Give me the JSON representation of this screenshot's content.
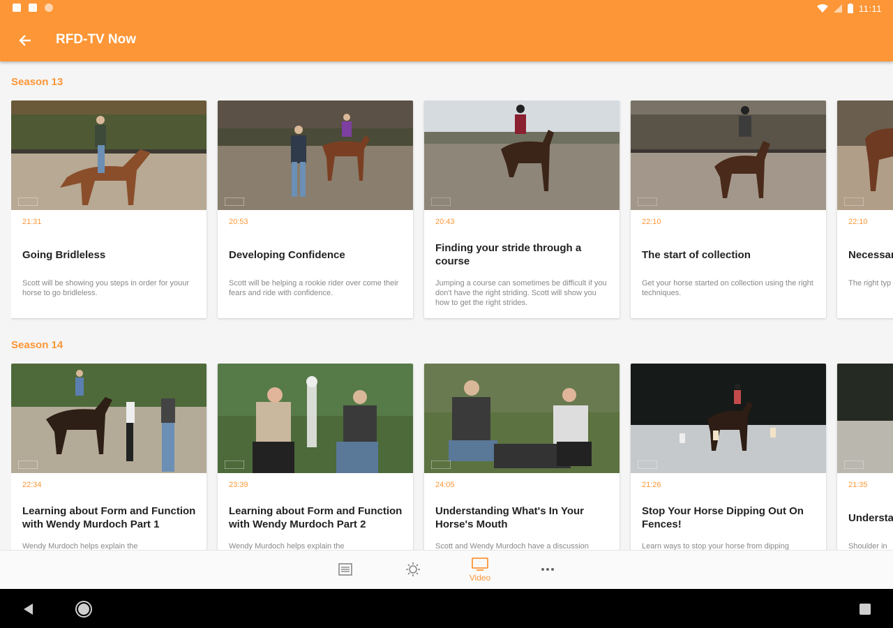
{
  "status_bar": {
    "time": "11:11"
  },
  "app_bar": {
    "title": "RFD-TV Now",
    "back_icon": "arrow-left-icon"
  },
  "colors": {
    "accent": "#fd9636",
    "title_text": "#222222",
    "desc_text": "#888888"
  },
  "seasons": [
    {
      "title": "Season 13",
      "episodes": [
        {
          "duration": "21:31",
          "title": "Going Bridleless",
          "description": "Scott will be showing you steps in order for youur horse to go bridleless."
        },
        {
          "duration": "20:53",
          "title": "Developing Confidence",
          "description": "Scott will be helping a rookie rider over come their fears and ride with confidence."
        },
        {
          "duration": "20:43",
          "title": "Finding your stride through a course",
          "description": "Jumping a course can sometimes be difficult if you don't have the right striding. Scott will show you how to get the right strides."
        },
        {
          "duration": "22:10",
          "title": "The start of collection",
          "description": "Get your horse started on collection using the right techniques."
        },
        {
          "duration": "22:10",
          "title": "Necessary young ho",
          "description": "The right typ horse will s future"
        }
      ]
    },
    {
      "title": "Season 14",
      "episodes": [
        {
          "duration": "22:34",
          "title": "Learning about Form and Function with Wendy Murdoch Part 1",
          "description": "Wendy Murdoch helps explain the"
        },
        {
          "duration": "23:39",
          "title": "Learning about Form and Function with Wendy Murdoch Part 2",
          "description": "Wendy Murdoch helps explain the"
        },
        {
          "duration": "24:05",
          "title": "Understanding What's In Your Horse's Mouth",
          "description": "Scott and Wendy Murdoch have a discussion"
        },
        {
          "duration": "21:26",
          "title": "Stop Your Horse Dipping Out On Fences!",
          "description": "Learn ways to stop your horse from dipping"
        },
        {
          "duration": "21:35",
          "title": "Understa",
          "description": "Shoulder in"
        }
      ]
    }
  ],
  "bottom_nav": [
    {
      "icon": "list-icon",
      "label": ""
    },
    {
      "icon": "sun-icon",
      "label": ""
    },
    {
      "icon": "tv-icon",
      "label": "Video"
    },
    {
      "icon": "more-icon",
      "label": ""
    }
  ],
  "system_nav": [
    "back-triangle-icon",
    "home-circle-icon",
    "recents-square-icon"
  ]
}
